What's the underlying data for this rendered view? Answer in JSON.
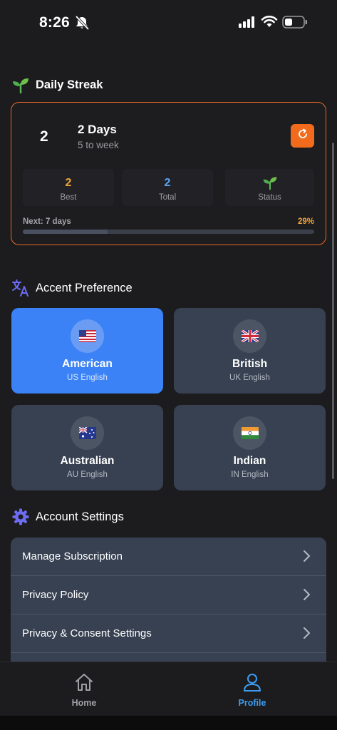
{
  "status_bar": {
    "time": "8:26"
  },
  "streak": {
    "section_title": "Daily Streak",
    "current": "2",
    "days_label": "2 Days",
    "subtitle": "5 to week",
    "stats": [
      {
        "value": "2",
        "label": "Best",
        "color": "#f2a33a"
      },
      {
        "value": "2",
        "label": "Total",
        "color": "#5aa6f5"
      },
      {
        "value": "",
        "label": "Status",
        "icon": "sprout-icon"
      }
    ],
    "next_label": "Next: 7 days",
    "progress_text": "29%",
    "progress_fraction": 0.29,
    "border_color": "#e8692a",
    "accent_color": "#f26b1d"
  },
  "accent": {
    "section_title": "Accent Preference",
    "options": [
      {
        "name": "American",
        "sub": "US English",
        "flag": "us-flag-icon",
        "selected": true
      },
      {
        "name": "British",
        "sub": "UK English",
        "flag": "uk-flag-icon",
        "selected": false
      },
      {
        "name": "Australian",
        "sub": "AU English",
        "flag": "au-flag-icon",
        "selected": false
      },
      {
        "name": "Indian",
        "sub": "IN English",
        "flag": "in-flag-icon",
        "selected": false
      }
    ],
    "selected_color": "#3b82f6"
  },
  "account": {
    "section_title": "Account Settings",
    "items": [
      {
        "label": "Manage Subscription"
      },
      {
        "label": "Privacy Policy"
      },
      {
        "label": "Privacy & Consent Settings"
      }
    ]
  },
  "tabbar": {
    "tabs": [
      {
        "label": "Home",
        "icon": "home-icon",
        "active": false
      },
      {
        "label": "Profile",
        "icon": "person-icon",
        "active": true
      }
    ],
    "active_color": "#3d9cf0",
    "inactive_color": "#a0a0a5"
  }
}
